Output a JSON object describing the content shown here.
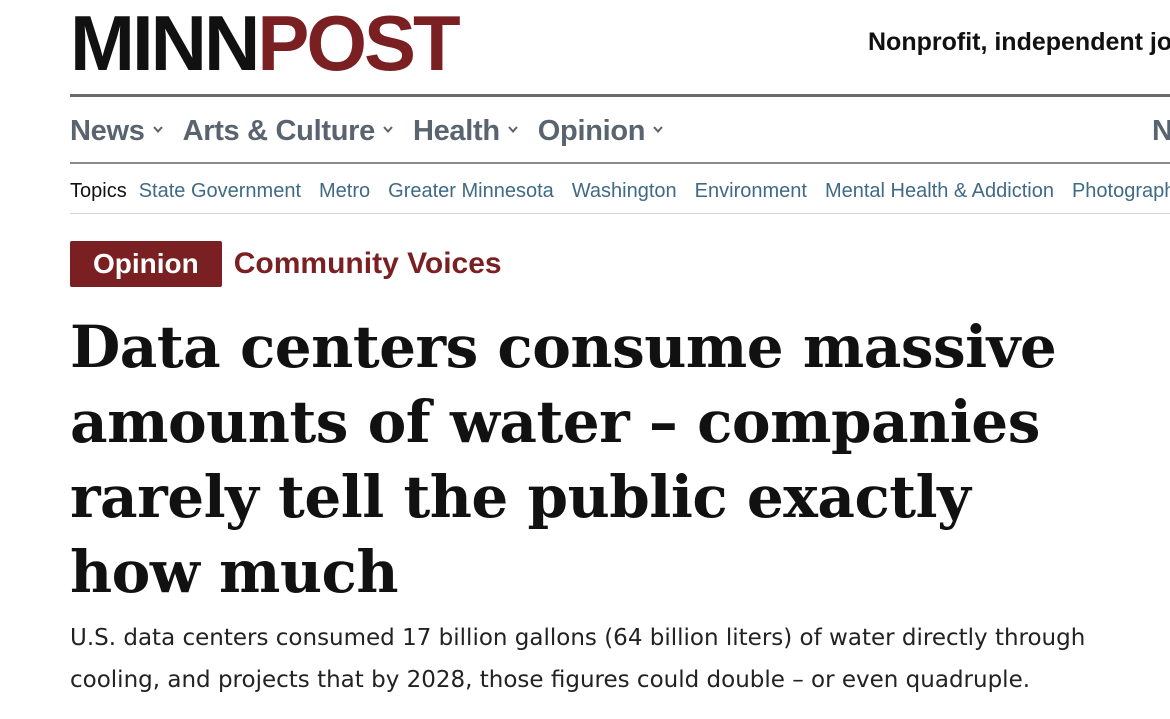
{
  "masthead": {
    "logo_dark": "MINN",
    "logo_accent": "POST",
    "tagline": "Nonprofit, independent jo"
  },
  "primary_nav": {
    "items": [
      {
        "label": "News"
      },
      {
        "label": "Arts & Culture"
      },
      {
        "label": "Health"
      },
      {
        "label": "Opinion"
      }
    ],
    "overflow_label": "N"
  },
  "topics": {
    "label": "Topics",
    "items": [
      "State Government",
      "Metro",
      "Greater Minnesota",
      "Washington",
      "Environment",
      "Mental Health & Addiction",
      "Photograph"
    ]
  },
  "article": {
    "badge": "Opinion",
    "section": "Community Voices",
    "headline": "Data centers consume massive amounts of water – companies rarely tell the public exactly how much",
    "dek": "U.S. data centers consumed 17 billion gallons (64 billion liters) of water directly through cooling, and projects that by 2028, those figures could double – or even quadruple."
  },
  "colors": {
    "brand": "#7a1f22",
    "nav_text": "#5a6470",
    "topic_link": "#3f6a85"
  },
  "icons": {
    "nav_dropdown": "chevron-down-icon"
  }
}
